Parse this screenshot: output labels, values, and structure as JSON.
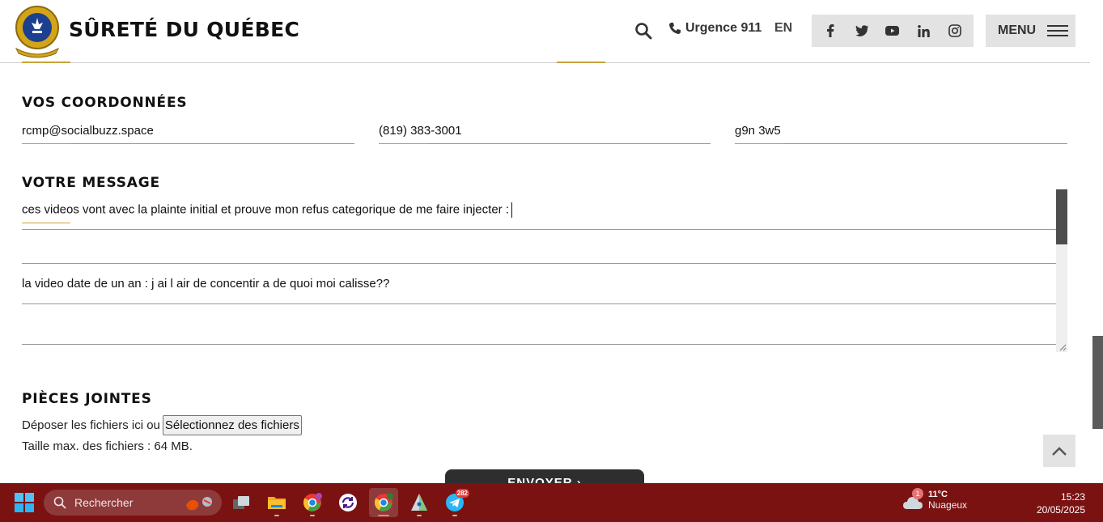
{
  "header": {
    "brand": "SÛRETÉ DU QUÉBEC",
    "urgence": "Urgence 911",
    "lang": "EN",
    "menu": "MENU"
  },
  "coordonnees": {
    "title": "VOS COORDONNÉES",
    "email": "rcmp@socialbuzz.space",
    "phone": "(819) 383-3001",
    "postal": "g9n 3w5"
  },
  "message": {
    "title": "VOTRE MESSAGE",
    "line1": "ces videos vont avec la plainte initial et prouve mon refus categorique de me faire injecter :",
    "line2": "",
    "line3": "la video date de un an : j ai l air de concentir a de quoi moi calisse??",
    "line4": ""
  },
  "attachments": {
    "title": "PIÈCES JOINTES",
    "drop_text": "Déposer les fichiers ici ou",
    "select_button": "Sélectionnez des fichiers",
    "max_size": "Taille max. des fichiers : 64 MB."
  },
  "send_button": "ENVOYER ›",
  "taskbar": {
    "search_placeholder": "Rechercher",
    "telegram_badge": "282",
    "weather_badge": "1",
    "temperature": "11°C",
    "condition": "Nuageux",
    "time": "15:23",
    "date": "20/05/2025"
  },
  "colors": {
    "accent_gold": "#c9a23a",
    "taskbar": "#7a1212"
  }
}
